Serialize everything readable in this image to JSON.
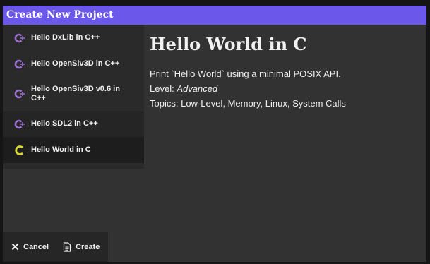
{
  "window": {
    "title": "Create New Project"
  },
  "projects": [
    {
      "label": "Hello DxLib in C++",
      "icon": "cpp-icon",
      "state": "normal"
    },
    {
      "label": "Hello OpenSiv3D in C++",
      "icon": "cpp-icon",
      "state": "normal"
    },
    {
      "label": "Hello OpenSiv3D v0.6 in C++",
      "icon": "cpp-icon",
      "state": "normal"
    },
    {
      "label": "Hello SDL2 in C++",
      "icon": "cpp-icon",
      "state": "hover"
    },
    {
      "label": "Hello World in C",
      "icon": "c-icon",
      "state": "selected"
    }
  ],
  "detail": {
    "title": "Hello World in C",
    "description": "Print `Hello World` using a minimal POSIX API.",
    "level_label": "Level:",
    "level_value": "Advanced",
    "topics_label": "Topics:",
    "topics_value": "Low-Level, Memory, Linux, System Calls"
  },
  "footer": {
    "cancel_label": "Cancel",
    "cancel_icon": "close-icon",
    "create_label": "Create",
    "create_icon": "document-icon"
  },
  "colors": {
    "accent": "#6b57ea",
    "cpp_icon": "#9b6fd0",
    "c_icon": "#d6d62f",
    "panel": "#323232"
  }
}
